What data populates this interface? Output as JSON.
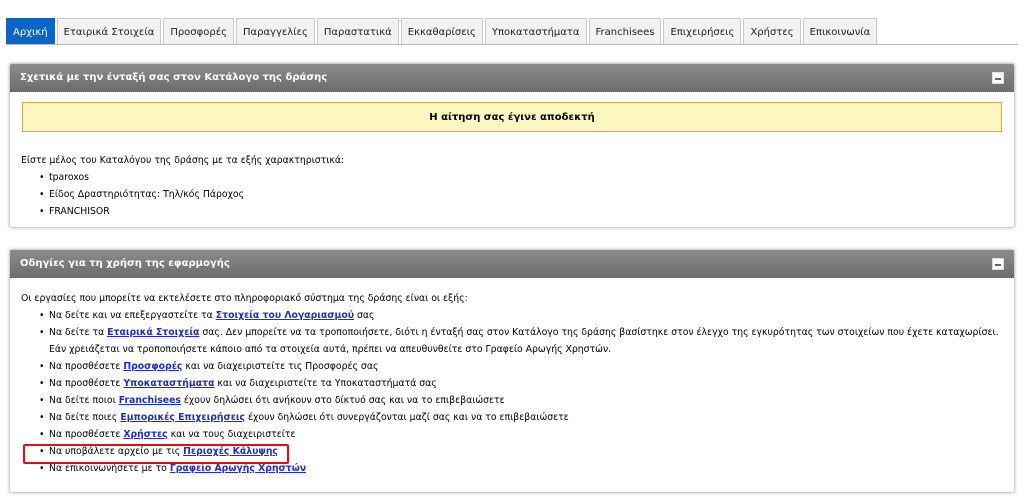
{
  "tabs": [
    {
      "label": "Αρχική",
      "active": true
    },
    {
      "label": "Εταιρικά Στοιχεία"
    },
    {
      "label": "Προσφορές"
    },
    {
      "label": "Παραγγελίες"
    },
    {
      "label": "Παραστατικά"
    },
    {
      "label": "Εκκαθαρίσεις"
    },
    {
      "label": "Υποκαταστήματα"
    },
    {
      "label": "Franchisees"
    },
    {
      "label": "Επιχειρήσεις"
    },
    {
      "label": "Χρήστες"
    },
    {
      "label": "Επικοινωνία"
    }
  ],
  "panel1": {
    "title": "Σχετικά με την ένταξή σας στον Κατάλογο της δράσης",
    "notice": "Η αίτηση σας έγινε αποδεκτή",
    "intro": "Είστε μέλος του Καταλόγου της δράσης με τα εξής χαρακτηριστικά:",
    "items": [
      "tparoxos",
      "Είδος Δραστηριότητας: Τηλ/κός Πάροχος",
      "FRANCHISOR"
    ]
  },
  "panel2": {
    "title": "Οδηγίες για τη χρήση της εφαρμογής",
    "intro": "Οι εργασίες που μπορείτε να εκτελέσετε στο πληροφοριακό σύστημα της δράσης είναι οι εξής:",
    "items": [
      {
        "pre": "Να δείτε και να επεξεργαστείτε τα ",
        "link": "Στοιχεία του Λογαριασμού",
        "post": " σας"
      },
      {
        "pre": "Να δείτε τα ",
        "link": "Εταιρικά Στοιχεία",
        "post": " σας. Δεν μπορείτε να τα τροποποιήσετε, διότι η ένταξή σας στον Κατάλογο της δράσης βασίστηκε στον έλεγχο της εγκυρότητας των στοιχείων που έχετε καταχωρίσει. Εάν χρειάζεται να τροποποιήσετε κάποιο από τα στοιχεία αυτά, πρέπει να απευθυνθείτε στο Γραφείο Αρωγής Χρηστών."
      },
      {
        "pre": "Να προσθέσετε ",
        "link": "Προσφορές",
        "post": " και να διαχειριστείτε τις Προσφορές σας"
      },
      {
        "pre": "Να προσθέσετε ",
        "link": "Υποκαταστήματα",
        "post": " και να διαχειριστείτε τα Υποκαταστήματά σας"
      },
      {
        "pre": "Να δείτε ποιοι ",
        "link": "Franchisees",
        "post": " έχουν δηλώσει ότι ανήκουν στο δίκτυό σας και να το επιβεβαιώσετε"
      },
      {
        "pre": "Να δείτε ποιες ",
        "link": "Εμπορικές Επιχειρήσεις",
        "post": " έχουν δηλώσει ότι συνεργάζονται μαζί σας και να το επιβεβαιώσετε"
      },
      {
        "pre": "Να προσθέσετε ",
        "link": "Χρήστες",
        "post": " και να τους διαχειριστείτε"
      },
      {
        "pre": "Να υποβάλετε αρχείο με τις ",
        "link": "Περιοχές Κάλυψης",
        "post": ""
      },
      {
        "pre": "Να επικοινωνήσετε με το ",
        "link": "Γραφείο Αρωγής Χρηστών",
        "post": ""
      }
    ]
  },
  "colors": {
    "accent": "#0b64c8",
    "highlight": "#e01010",
    "notice_bg": "#fdf6c0"
  }
}
